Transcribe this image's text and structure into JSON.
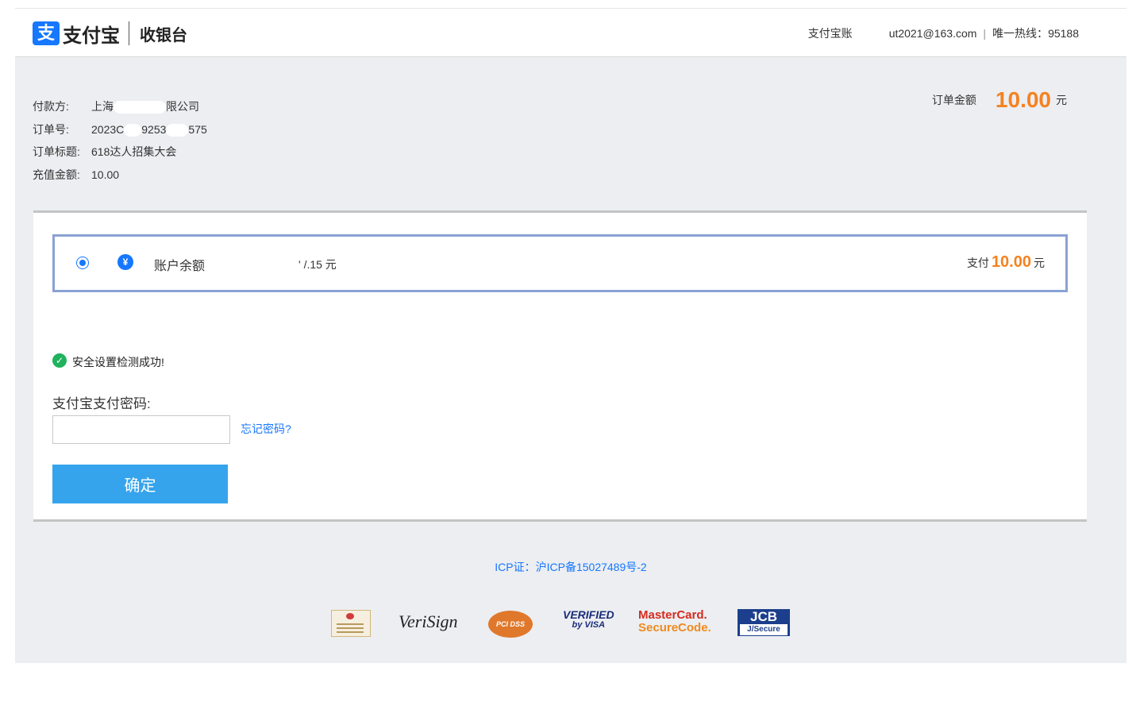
{
  "header": {
    "logo_mark": "支",
    "logo_text": "支付宝",
    "subtitle": "收银台",
    "account_prefix": "支付宝账",
    "account_suffix": "ut2021@163.com",
    "hotline_label": "唯一热线：",
    "hotline_number": "95188"
  },
  "order": {
    "payer_label": "付款方:",
    "payer_start": "上海",
    "payer_end": "限公司",
    "order_no_label": "订单号:",
    "order_no_a": "2023C",
    "order_no_b": "9253",
    "order_no_c": "575",
    "title_label": "订单标题:",
    "title_value": "618达人招集大会",
    "recharge_label": "充值金额:",
    "recharge_value": "10.00",
    "amount_label": "订单金额",
    "amount_value": "10.00",
    "amount_unit": "元"
  },
  "payment_method": {
    "coin_glyph": "¥",
    "name": "账户余额",
    "balance": "'  /.15 元",
    "pay_label": "支付",
    "pay_value": "10.00",
    "pay_unit": "元"
  },
  "security": {
    "check_glyph": "✓",
    "message": "安全设置检测成功!"
  },
  "password": {
    "label": "支付宝支付密码:",
    "value": "",
    "forgot_link": "忘记密码?"
  },
  "confirm_button": "确定",
  "footer": {
    "icp": "ICP证：沪ICP备15027489号-2",
    "badges": {
      "verisign": "VeriSign",
      "pci": "PCI DSS",
      "visa_a": "VERIFIED",
      "visa_b": "by VISA",
      "mc_a": "MasterCard.",
      "mc_b": "SecureCode.",
      "jcb_a": "JCB",
      "jcb_b": "J/Secure"
    }
  },
  "colors": {
    "brand_blue": "#1677ff",
    "amount_orange": "#f58220",
    "confirm_button": "#36a4ec",
    "success_green": "#20b25d"
  }
}
